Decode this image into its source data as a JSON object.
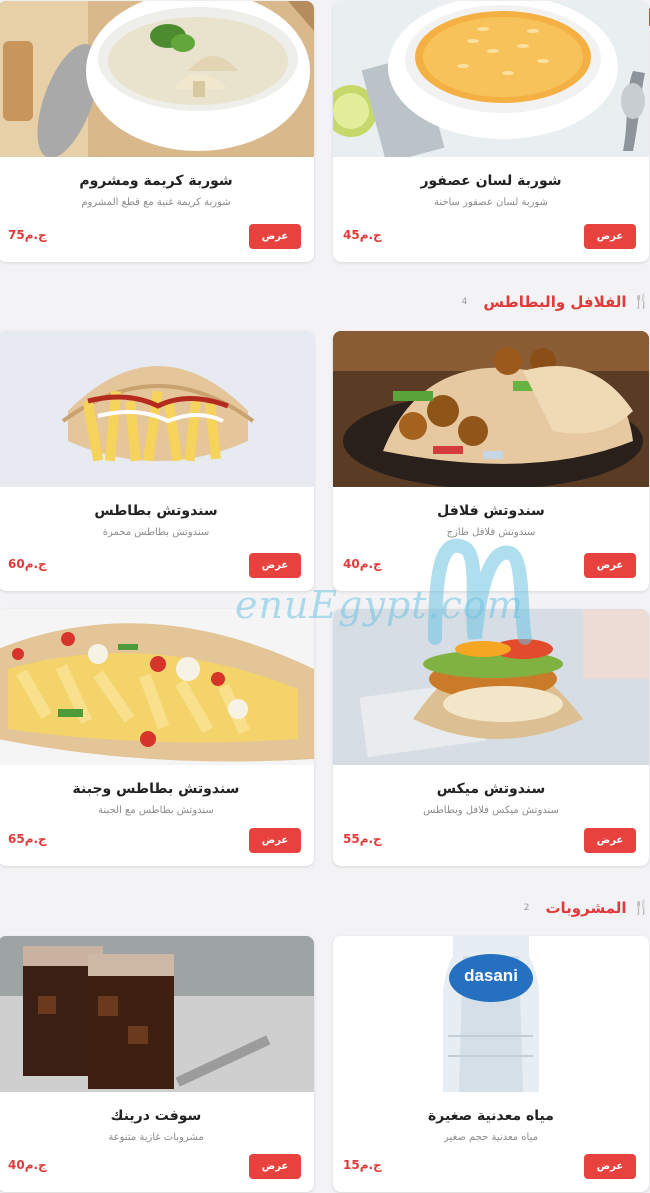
{
  "sections": {
    "falafel": {
      "title": "الفلافل والبطاطس",
      "count": "4",
      "icon": "utensils-icon"
    },
    "drinks": {
      "title": "المشروبات",
      "count": "2",
      "icon": "utensils-icon"
    }
  },
  "items": {
    "soup_orzo": {
      "name": "شوربة لسان عصفور",
      "desc": "شوربة لسان عصفور ساخنة",
      "price": "45ج.م",
      "button": "عرض"
    },
    "soup_mushroom": {
      "name": "شوربة كريمة ومشروم",
      "desc": "شوربة كريمة غنية مع قطع المشروم",
      "price": "75ج.م",
      "button": "عرض"
    },
    "falafel_sandwich": {
      "name": "سندوتش فلافل",
      "desc": "سندوتش فلافل طازج",
      "price": "40ج.م",
      "button": "عرض"
    },
    "fries_sandwich": {
      "name": "سندوتش بطاطس",
      "desc": "سندوتش بطاطس محمرة",
      "price": "60ج.م",
      "button": "عرض"
    },
    "mix_sandwich": {
      "name": "سندوتش ميكس",
      "desc": "سندوتش ميكس فلافل وبطاطس",
      "price": "55ج.م",
      "button": "عرض"
    },
    "fries_cheese_sandwich": {
      "name": "سندوتش بطاطس وجبنة",
      "desc": "سندوتش بطاطس مع الجبنة",
      "price": "65ج.م",
      "button": "عرض"
    },
    "water_small": {
      "name": "مياه معدنية صغيرة",
      "desc": "مياه معدنية حجم صغير",
      "price": "15ج.م",
      "button": "عرض"
    },
    "soft_drink": {
      "name": "سوفت درينك",
      "desc": "مشروبات غازية متنوعة",
      "price": "40ج.م",
      "button": "عرض"
    }
  },
  "watermark": {
    "text": "enuEgypt.com"
  },
  "bottle_brand": "dasani",
  "colors": {
    "accent": "#e8423f",
    "price": "#e03a3a",
    "background": "#f3f3f5"
  }
}
